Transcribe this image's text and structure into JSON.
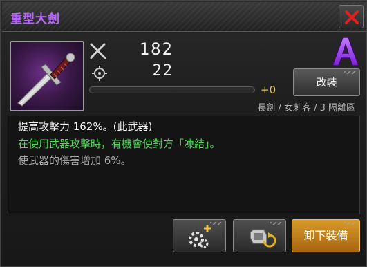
{
  "window": {
    "title": "重型大劍",
    "close_icon": "close-x-icon"
  },
  "item": {
    "icon": "greatsword-icon",
    "grade": "A",
    "grade_color": "#9b3cff",
    "attack": "182",
    "accuracy": "22",
    "enhance_level": "+0",
    "enhance_progress": 0,
    "class_info": "長劍 / 女刺客 / 3 隔離區"
  },
  "buttons": {
    "remodel_label": "改裝",
    "unequip_label": "卸下裝備"
  },
  "description": {
    "line1": "提高攻擊力 162%。(此武器)",
    "line2": "在使用武器攻擊時，有機會使對方「凍結」。",
    "line3": "使武器的傷害增加 6%。"
  },
  "colors": {
    "title": "#b865ff",
    "effect_text": "#53d65a",
    "primary_button": "#d89a2a",
    "close_icon": "#e02020"
  }
}
